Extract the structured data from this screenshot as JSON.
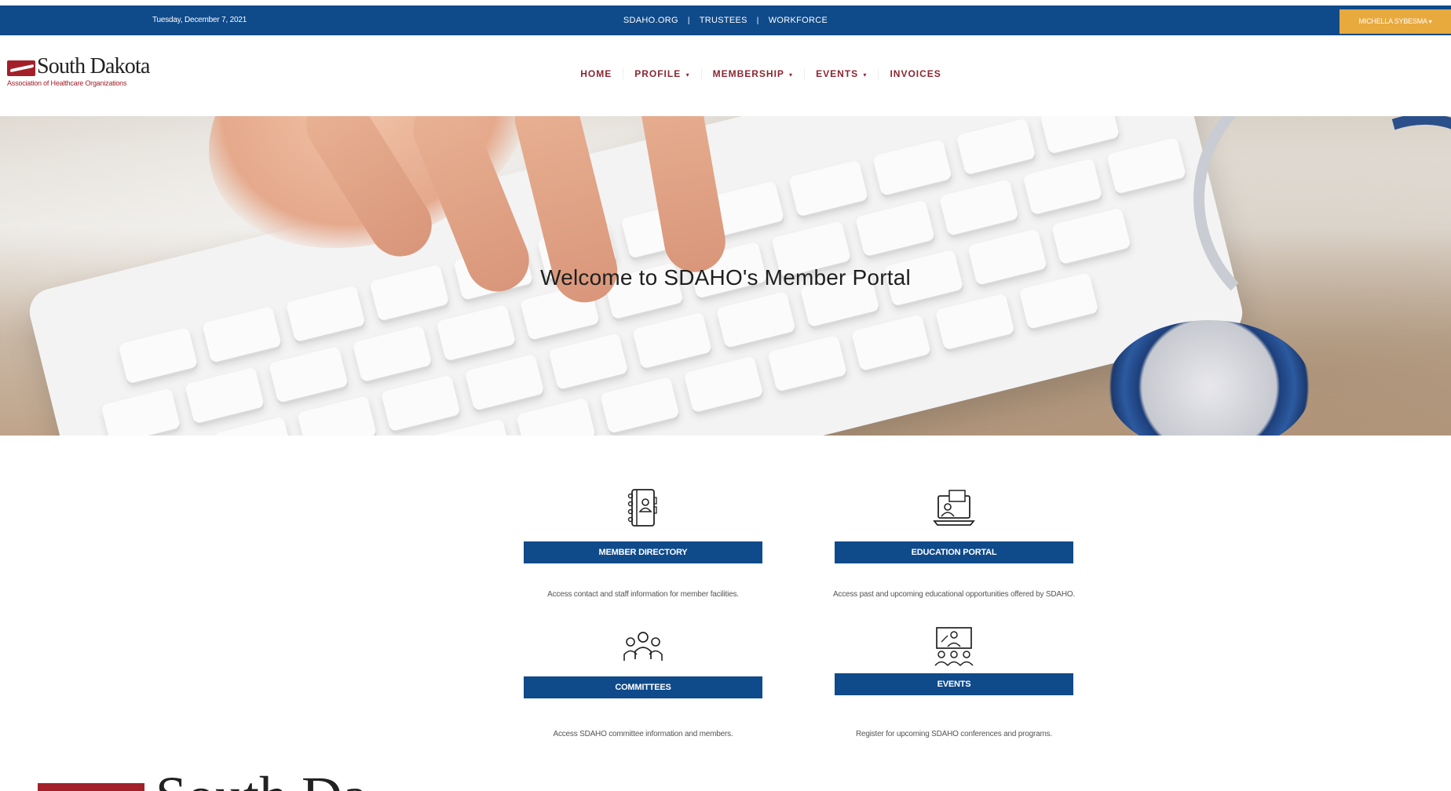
{
  "topbar": {
    "date": "Tuesday, December 7, 2021",
    "links": [
      "SDAHO.ORG",
      "TRUSTEES",
      "WORKFORCE"
    ],
    "separator": "|",
    "user_name": "MICHELLA SYBESMA",
    "user_caret": "▾"
  },
  "header": {
    "logo_name": "South Dakota",
    "logo_tagline": "Association of Healthcare Organizations",
    "nav": [
      {
        "label": "HOME",
        "caret": ""
      },
      {
        "label": "PROFILE",
        "caret": "▾"
      },
      {
        "label": "MEMBERSHIP",
        "caret": "▾"
      },
      {
        "label": "EVENTS",
        "caret": "▾"
      },
      {
        "label": "INVOICES",
        "caret": ""
      }
    ]
  },
  "hero": {
    "title": "Welcome to SDAHO's Member Portal"
  },
  "tiles": [
    {
      "icon": "address-book-icon",
      "button": "MEMBER DIRECTORY",
      "description": "Access contact and staff information for member facilities."
    },
    {
      "icon": "laptop-video-icon",
      "button": "EDUCATION PORTAL",
      "description": "Access past and upcoming educational opportunities offered by SDAHO."
    },
    {
      "icon": "group-people-icon",
      "button": "COMMITTEES",
      "description": "Access SDAHO committee information and members."
    },
    {
      "icon": "presentation-audience-icon",
      "button": "EVENTS",
      "description": "Register for upcoming SDAHO conferences and programs."
    }
  ],
  "footer": {
    "logo_name": "South Dako"
  },
  "colors": {
    "primary_blue": "#0f4a8a",
    "brand_red": "#a3202a",
    "accent_orange": "#e8a93d",
    "nav_text": "#8b2631"
  }
}
